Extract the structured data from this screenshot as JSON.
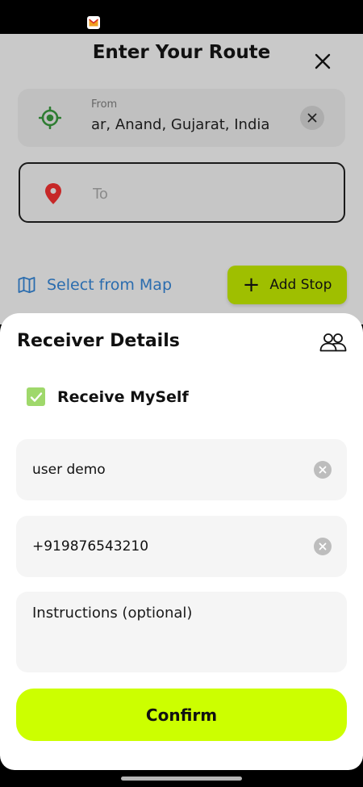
{
  "status_bar": {
    "notification_icon": "gmail-icon"
  },
  "route": {
    "title": "Enter Your Route",
    "close_icon": "close-icon",
    "from": {
      "label": "From",
      "value": "ar, Anand, Gujarat, India",
      "icon": "location-target-icon"
    },
    "to": {
      "placeholder": "To",
      "value": "",
      "icon": "map-pin-icon"
    },
    "select_from_map": "Select from Map",
    "add_stop": "Add Stop"
  },
  "receiver": {
    "title": "Receiver Details",
    "contacts_icon": "people-icon",
    "receive_myself": {
      "label": "Receive MySelf",
      "checked": true
    },
    "name": {
      "value": "user demo"
    },
    "phone": {
      "value": "+919876543210"
    },
    "instructions": {
      "placeholder": "Instructions (optional)",
      "value": ""
    },
    "confirm": "Confirm"
  },
  "colors": {
    "accent": "#ccff00",
    "add_stop_bg": "#9fbf00",
    "checkbox": "#9fd86b",
    "link_blue": "#2a6cae",
    "pin_red": "#c62828",
    "target_green": "#2e7d32"
  }
}
